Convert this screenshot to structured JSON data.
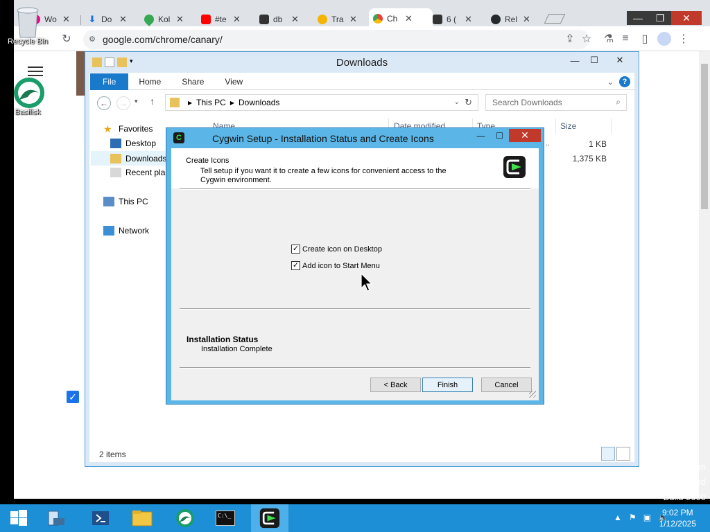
{
  "desktop": {
    "icons": [
      {
        "label": "Recycle Bin",
        "icon": "recycle-bin-icon"
      },
      {
        "label": "Basilisk",
        "icon": "basilisk-icon"
      }
    ],
    "watermark": [
      "ition",
      "nse: expired",
      "Build 9600"
    ]
  },
  "browser": {
    "tabs": [
      {
        "label": "Wo",
        "icon": "flickr-icon"
      },
      {
        "label": "Do",
        "icon": "download-icon"
      },
      {
        "label": "Kol",
        "icon": "maps-pin-icon"
      },
      {
        "label": "#te",
        "icon": "youtube-icon"
      },
      {
        "label": "db",
        "icon": "page-thumb-icon"
      },
      {
        "label": "Tra",
        "icon": "location-icon"
      },
      {
        "label": "Ch",
        "icon": "chrome-icon",
        "active": true
      },
      {
        "label": "6 (",
        "icon": "page-thumb-icon"
      },
      {
        "label": "Rel",
        "icon": "github-icon"
      }
    ],
    "close_glyph": "✕",
    "address": "google.com/chrome/canary/",
    "window_controls": {
      "minimize": "—",
      "maximize": "❐",
      "close": "✕"
    }
  },
  "explorer": {
    "title": "Downloads",
    "ribbon_tabs": [
      "File",
      "Home",
      "Share",
      "View"
    ],
    "breadcrumb": [
      "This PC",
      "Downloads"
    ],
    "search_placeholder": "Search Downloads",
    "columns": [
      "Name",
      "Date modified",
      "Type",
      "Size"
    ],
    "sizes": [
      "1 KB",
      "1,375 KB"
    ],
    "type_fragment": "..",
    "nav": {
      "favorites": "Favorites",
      "desktop": "Desktop",
      "downloads": "Downloads",
      "recent": "Recent plac",
      "this_pc": "This PC",
      "network": "Network"
    },
    "status": "2 items"
  },
  "dialog": {
    "title": "Cygwin Setup - Installation Status and Create Icons",
    "header_title": "Create Icons",
    "header_desc": "Tell setup if you want it to create a few icons for convenient access to the Cygwin environment.",
    "options": [
      {
        "label": "Create icon on Desktop",
        "checked": true
      },
      {
        "label": "Add icon to Start Menu",
        "checked": true
      }
    ],
    "status_heading": "Installation Status",
    "status_value": "Installation Complete",
    "buttons": {
      "back": "< Back",
      "finish": "Finish",
      "cancel": "Cancel"
    },
    "logo_glyph": "C"
  },
  "taskbar": {
    "time": "9:02 PM",
    "date": "1/12/2025",
    "terminal_glyph": "C:\\_"
  },
  "colors": {
    "taskbar": "#1c8fd6",
    "dialog_frame": "#5bb6e7",
    "ribbon_file": "#1979ca",
    "close_red": "#c0392b"
  }
}
